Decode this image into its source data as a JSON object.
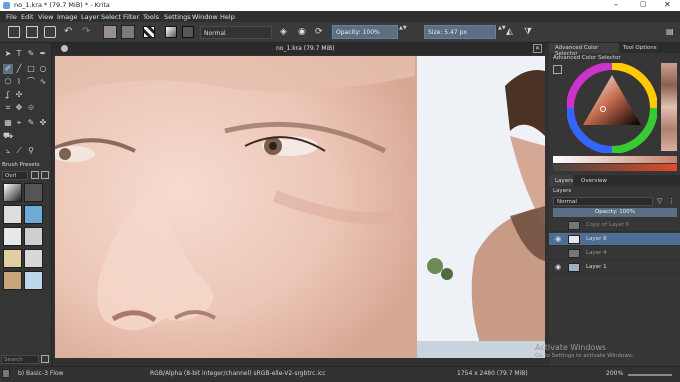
{
  "window": {
    "title": "no_1.kra * (79.7 MiB) * - Krita"
  },
  "menu": [
    "File",
    "Edit",
    "View",
    "Image",
    "Layer",
    "Select",
    "Filter",
    "Tools",
    "Settings",
    "Window",
    "Help"
  ],
  "toolbar": {
    "blend_mode": "Normal",
    "opacity_label": "Opacity: 100%",
    "size_label": "Size: 5.47 px"
  },
  "canvas": {
    "tab_title": "no_1.kra (79.7 MiB)"
  },
  "brush_presets": {
    "title": "Brush Presets",
    "tag": "Ovrl",
    "search_placeholder": "Search"
  },
  "docker": {
    "tabs": [
      "Advanced Color Selector",
      "Tool Options"
    ],
    "color_selector_title": "Advanced Color Selector",
    "panel_tabs": [
      "Layers",
      "Overview"
    ],
    "layers_title": "Layers",
    "blend_mode": "Normal",
    "opacity_label": "Opacity: 100%",
    "layers": [
      {
        "name": "Copy of Layer 6"
      },
      {
        "name": "Layer 8"
      },
      {
        "name": "Layer 4"
      },
      {
        "name": "Layer 1"
      }
    ],
    "watermark_title": "Activate Windows",
    "watermark_subtitle": "Go to Settings to activate Windows."
  },
  "status": {
    "brush": "b) Basic-3 Flow",
    "color_space": "RGB/Alpha (8-bit integer/channel)  sRGB-elle-V2-srgbtrc.icc",
    "dimensions": "1754 x 2480 (79.7 MiB)",
    "zoom": "200%"
  },
  "colors": {
    "accent": "#5a6e84",
    "selected_layer": "#4f6e94",
    "skin": "#f1d2c4",
    "background": "#313131"
  }
}
